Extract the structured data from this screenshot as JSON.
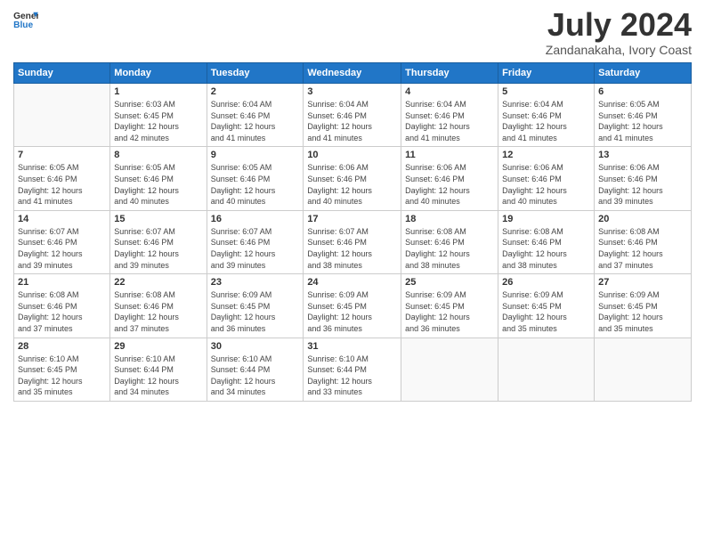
{
  "header": {
    "logo_line1": "General",
    "logo_line2": "Blue",
    "month_title": "July 2024",
    "location": "Zandanakaha, Ivory Coast"
  },
  "weekdays": [
    "Sunday",
    "Monday",
    "Tuesday",
    "Wednesday",
    "Thursday",
    "Friday",
    "Saturday"
  ],
  "weeks": [
    [
      {
        "day": "",
        "empty": true
      },
      {
        "day": "1",
        "sunrise": "6:03 AM",
        "sunset": "6:45 PM",
        "daylight": "12 hours and 42 minutes."
      },
      {
        "day": "2",
        "sunrise": "6:04 AM",
        "sunset": "6:46 PM",
        "daylight": "12 hours and 41 minutes."
      },
      {
        "day": "3",
        "sunrise": "6:04 AM",
        "sunset": "6:46 PM",
        "daylight": "12 hours and 41 minutes."
      },
      {
        "day": "4",
        "sunrise": "6:04 AM",
        "sunset": "6:46 PM",
        "daylight": "12 hours and 41 minutes."
      },
      {
        "day": "5",
        "sunrise": "6:04 AM",
        "sunset": "6:46 PM",
        "daylight": "12 hours and 41 minutes."
      },
      {
        "day": "6",
        "sunrise": "6:05 AM",
        "sunset": "6:46 PM",
        "daylight": "12 hours and 41 minutes."
      }
    ],
    [
      {
        "day": "7",
        "sunrise": "6:05 AM",
        "sunset": "6:46 PM",
        "daylight": "12 hours and 41 minutes."
      },
      {
        "day": "8",
        "sunrise": "6:05 AM",
        "sunset": "6:46 PM",
        "daylight": "12 hours and 40 minutes."
      },
      {
        "day": "9",
        "sunrise": "6:05 AM",
        "sunset": "6:46 PM",
        "daylight": "12 hours and 40 minutes."
      },
      {
        "day": "10",
        "sunrise": "6:06 AM",
        "sunset": "6:46 PM",
        "daylight": "12 hours and 40 minutes."
      },
      {
        "day": "11",
        "sunrise": "6:06 AM",
        "sunset": "6:46 PM",
        "daylight": "12 hours and 40 minutes."
      },
      {
        "day": "12",
        "sunrise": "6:06 AM",
        "sunset": "6:46 PM",
        "daylight": "12 hours and 40 minutes."
      },
      {
        "day": "13",
        "sunrise": "6:06 AM",
        "sunset": "6:46 PM",
        "daylight": "12 hours and 39 minutes."
      }
    ],
    [
      {
        "day": "14",
        "sunrise": "6:07 AM",
        "sunset": "6:46 PM",
        "daylight": "12 hours and 39 minutes."
      },
      {
        "day": "15",
        "sunrise": "6:07 AM",
        "sunset": "6:46 PM",
        "daylight": "12 hours and 39 minutes."
      },
      {
        "day": "16",
        "sunrise": "6:07 AM",
        "sunset": "6:46 PM",
        "daylight": "12 hours and 39 minutes."
      },
      {
        "day": "17",
        "sunrise": "6:07 AM",
        "sunset": "6:46 PM",
        "daylight": "12 hours and 38 minutes."
      },
      {
        "day": "18",
        "sunrise": "6:08 AM",
        "sunset": "6:46 PM",
        "daylight": "12 hours and 38 minutes."
      },
      {
        "day": "19",
        "sunrise": "6:08 AM",
        "sunset": "6:46 PM",
        "daylight": "12 hours and 38 minutes."
      },
      {
        "day": "20",
        "sunrise": "6:08 AM",
        "sunset": "6:46 PM",
        "daylight": "12 hours and 37 minutes."
      }
    ],
    [
      {
        "day": "21",
        "sunrise": "6:08 AM",
        "sunset": "6:46 PM",
        "daylight": "12 hours and 37 minutes."
      },
      {
        "day": "22",
        "sunrise": "6:08 AM",
        "sunset": "6:46 PM",
        "daylight": "12 hours and 37 minutes."
      },
      {
        "day": "23",
        "sunrise": "6:09 AM",
        "sunset": "6:45 PM",
        "daylight": "12 hours and 36 minutes."
      },
      {
        "day": "24",
        "sunrise": "6:09 AM",
        "sunset": "6:45 PM",
        "daylight": "12 hours and 36 minutes."
      },
      {
        "day": "25",
        "sunrise": "6:09 AM",
        "sunset": "6:45 PM",
        "daylight": "12 hours and 36 minutes."
      },
      {
        "day": "26",
        "sunrise": "6:09 AM",
        "sunset": "6:45 PM",
        "daylight": "12 hours and 35 minutes."
      },
      {
        "day": "27",
        "sunrise": "6:09 AM",
        "sunset": "6:45 PM",
        "daylight": "12 hours and 35 minutes."
      }
    ],
    [
      {
        "day": "28",
        "sunrise": "6:10 AM",
        "sunset": "6:45 PM",
        "daylight": "12 hours and 35 minutes."
      },
      {
        "day": "29",
        "sunrise": "6:10 AM",
        "sunset": "6:44 PM",
        "daylight": "12 hours and 34 minutes."
      },
      {
        "day": "30",
        "sunrise": "6:10 AM",
        "sunset": "6:44 PM",
        "daylight": "12 hours and 34 minutes."
      },
      {
        "day": "31",
        "sunrise": "6:10 AM",
        "sunset": "6:44 PM",
        "daylight": "12 hours and 33 minutes."
      },
      {
        "day": "",
        "empty": true
      },
      {
        "day": "",
        "empty": true
      },
      {
        "day": "",
        "empty": true
      }
    ]
  ]
}
